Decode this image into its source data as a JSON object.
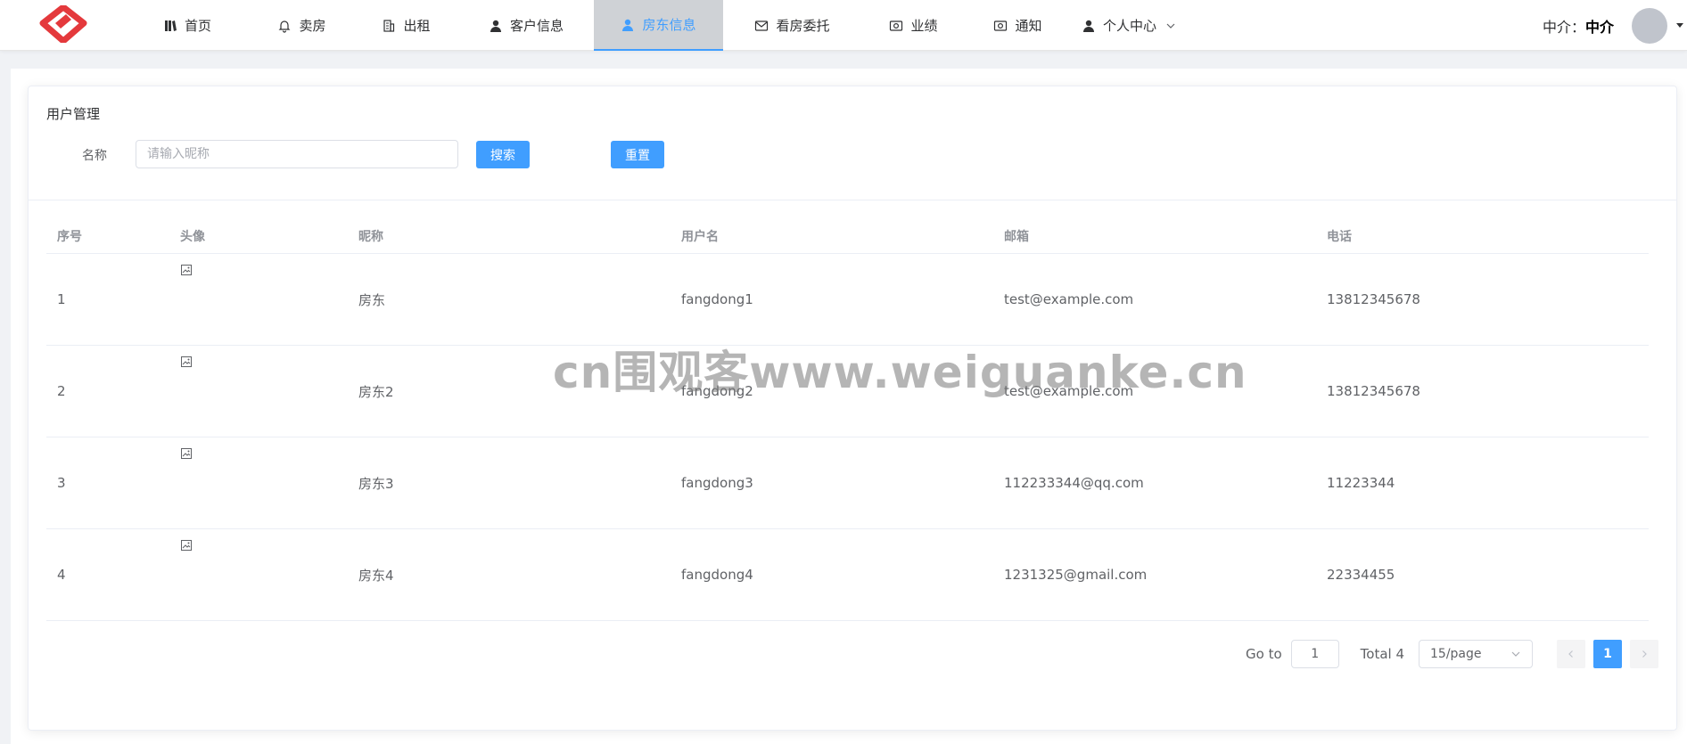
{
  "nav": {
    "items": [
      {
        "label": "首页",
        "icon": "book-icon",
        "active": false,
        "width": 140
      },
      {
        "label": "卖房",
        "icon": "bell-icon",
        "active": false,
        "width": 117
      },
      {
        "label": "出租",
        "icon": "building-icon",
        "active": false,
        "width": 117
      },
      {
        "label": "客户信息",
        "icon": "user-icon",
        "active": false,
        "width": 152
      },
      {
        "label": "房东信息",
        "icon": "user-icon",
        "active": true,
        "width": 145
      },
      {
        "label": "看房委托",
        "icon": "mail-icon",
        "active": false,
        "width": 155
      },
      {
        "label": "业绩",
        "icon": "money-icon",
        "active": false,
        "width": 117
      },
      {
        "label": "通知",
        "icon": "money-icon",
        "active": false,
        "width": 117
      },
      {
        "label": "个人中心",
        "icon": "user-icon",
        "active": false,
        "width": 132,
        "dropdown": true
      }
    ],
    "accent": "#409eff"
  },
  "user": {
    "prefix": "中介：",
    "name": "中介"
  },
  "card": {
    "title": "用户管理"
  },
  "search": {
    "label": "名称",
    "placeholder": "请输入昵称",
    "value": "",
    "search_button": "搜索",
    "reset_button": "重置"
  },
  "table": {
    "headers": [
      "序号",
      "头像",
      "昵称",
      "用户名",
      "邮箱",
      "电话"
    ],
    "rows": [
      {
        "index": "1",
        "nickname": "房东",
        "username": "fangdong1",
        "email": "test@example.com",
        "phone": "13812345678"
      },
      {
        "index": "2",
        "nickname": "房东2",
        "username": "fangdong2",
        "email": "test@example.com",
        "phone": "13812345678"
      },
      {
        "index": "3",
        "nickname": "房东3",
        "username": "fangdong3",
        "email": "112233344@qq.com",
        "phone": "11223344"
      },
      {
        "index": "4",
        "nickname": "房东4",
        "username": "fangdong4",
        "email": "1231325@gmail.com",
        "phone": "22334455"
      }
    ]
  },
  "pagination": {
    "goto_label": "Go to",
    "goto_value": "1",
    "total": "Total 4",
    "page_size": "15/page",
    "current_page": "1"
  },
  "watermark": "cn围观客www.weiguanke.cn"
}
